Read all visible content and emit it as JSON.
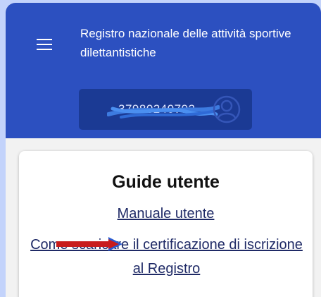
{
  "header": {
    "title": "Registro nazionale delle attività sportive dilettantistiche",
    "user_id": "37980240792",
    "bg_color": "#2c50c0"
  },
  "guides": {
    "title": "Guide utente",
    "links": [
      "Manuale utente",
      "Come scaricare il certificazione di iscrizione al Registro"
    ]
  },
  "icons": {
    "menu": "menu-icon",
    "avatar": "user-avatar-icon",
    "annotation": "red-arrow-annotation"
  }
}
